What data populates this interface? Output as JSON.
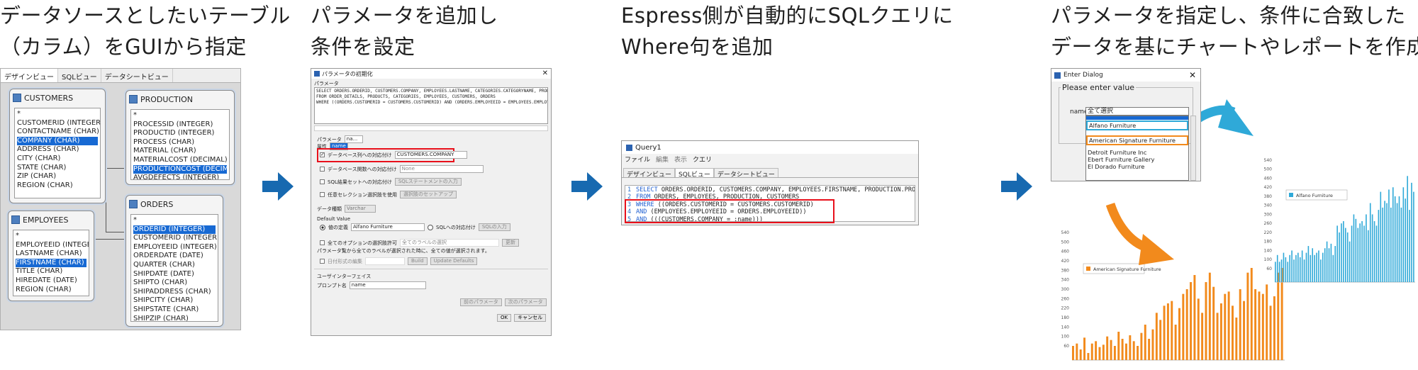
{
  "steps": [
    {
      "line1": "データソースとしたいテーブル",
      "line2": "（カラム）をGUIから指定"
    },
    {
      "line1": "パラメータを追加し",
      "line2": "条件を設定"
    },
    {
      "line1": "Espress側が自動的にSQLクエリに",
      "line2": "Where句を追加"
    },
    {
      "line1": "パラメータを指定し、条件に合致した",
      "line2": "データを基にチャートやレポートを作成"
    }
  ],
  "design_view": {
    "tabs": [
      "デザインビュー",
      "SQLビュー",
      "データシートビュー"
    ],
    "tables": {
      "customers": {
        "name": "CUSTOMERS",
        "columns": [
          "*",
          "CUSTOMERID (INTEGER)",
          "CONTACTNAME (CHAR)",
          "COMPANY (CHAR)",
          "ADDRESS (CHAR)",
          "CITY (CHAR)",
          "STATE (CHAR)",
          "ZIP (CHAR)",
          "REGION (CHAR)"
        ]
      },
      "production": {
        "name": "PRODUCTION",
        "columns": [
          "*",
          "PROCESSID (INTEGER)",
          "PRODUCTID (INTEGER)",
          "PROCESS (CHAR)",
          "MATERIAL (CHAR)",
          "MATERIALCOST (DECIMAL)",
          "PRODUCTIONCOST (DECIMAL)",
          "AVGDEFECTS (INTEGER)"
        ]
      },
      "employees": {
        "name": "EMPLOYEES",
        "columns": [
          "*",
          "EMPLOYEEID (INTEGER)",
          "LASTNAME (CHAR)",
          "FIRSTNAME (CHAR)",
          "TITLE (CHAR)",
          "HIREDATE (DATE)",
          "REGION (CHAR)"
        ]
      },
      "orders": {
        "name": "ORDERS",
        "columns": [
          "*",
          "ORDERID (INTEGER)",
          "CUSTOMERID (INTEGER)",
          "EMPLOYEEID (INTEGER)",
          "ORDERDATE (DATE)",
          "QUARTER (CHAR)",
          "SHIPDATE (DATE)",
          "SHIPTO (CHAR)",
          "SHIPADDRESS (CHAR)",
          "SHIPCITY (CHAR)",
          "SHIPSTATE (CHAR)",
          "SHIPZIP (CHAR)"
        ]
      }
    }
  },
  "param_dialog": {
    "title": "パラメータの初期化",
    "param_label": "パラメータ",
    "sql_lines": [
      "SELECT ORDERS.ORDERID, CUSTOMERS.COMPANY, EMPLOYEES.LASTNAME, CATEGORIES.CATEGORYNAME, PRODUCTS.PRODUCTNAME",
      "FROM ORDER_DETAILS, PRODUCTS, CATEGORIES, EMPLOYEES, CUSTOMERS, ORDERS",
      "WHERE ((ORDERS.CUSTOMERID = CUSTOMERS.CUSTOMERID) AND (ORDERS.EMPLOYEEID = EMPLOYEES.EMPLOYEEID))"
    ],
    "param_field_label": "パラメータ",
    "param_value": "na...",
    "attr_label": "属性",
    "attr_value": "name",
    "db_col_label": "データベース列への対応付け",
    "db_col_value": "CUSTOMERS.COMPANY",
    "db_related_label": "データベース関数への対応付け",
    "db_related_value": "None",
    "sql_result_label": "SQL結果セットへの対応付け",
    "sql_result_btn": "SQLステートメントの入力",
    "any_select_label": "任意セレクション選択肢を使用",
    "any_select_btn": "選択肢のセットアップ",
    "data_type_label": "データ種類",
    "data_type_value": "Varchar",
    "default_label": "Default Value",
    "radio_value_label": "値の定義",
    "radio_value": "Alfano Furniture",
    "radio_sql_label": "SQLへの対応付け",
    "radio_sql_btn": "SQLの入力",
    "all_options_label": "全てのオプションの選択肢許可",
    "all_options_field": "全てのラベルの選択",
    "all_options_btn": "更新",
    "note": "パラメータ覧から全てのラベルが選択された時に、全ての値が選択されます。",
    "date_label": "日付形式の編集",
    "build_btn": "Build",
    "update_btn": "Update Defaults",
    "ui_label": "ユーザインターフェイス",
    "prompt_label": "プロンプト名",
    "prompt_value": "name",
    "prev_btn": "前のパラメータ",
    "next_btn": "次のパラメータ",
    "ok_btn": "OK",
    "cancel_btn": "キャンセル"
  },
  "query": {
    "title": "Query1",
    "menu": [
      "ファイル",
      "編集",
      "表示",
      "クエリ"
    ],
    "tabs": [
      "デザインビュー",
      "SQLビュー",
      "データシートビュー"
    ],
    "lines": [
      {
        "n": "1",
        "kw": "SELECT",
        "rest": " ORDERS.ORDERID, CUSTOMERS.COMPANY, EMPLOYEES.FIRSTNAME, PRODUCTION.PRODUCTIONCOST"
      },
      {
        "n": "2",
        "kw": "FROM",
        "rest": " ORDERS, EMPLOYEES, PRODUCTION, CUSTOMERS"
      },
      {
        "n": "3",
        "kw": "WHERE",
        "rest": " ((ORDERS.CUSTOMERID = CUSTOMERS.CUSTOMERID)"
      },
      {
        "n": "4",
        "kw": "AND",
        "rest": " (EMPLOYEES.EMPLOYEEID = ORDERS.EMPLOYEEID))"
      },
      {
        "n": "5",
        "kw": "AND",
        "rest": " (((CUSTOMERS.COMPANY = :name)))"
      }
    ]
  },
  "enter_dialog": {
    "title": "Enter Dialog",
    "group_label": "Please enter value",
    "name_label": "name",
    "selected": "全て選択",
    "options": [
      "Alfano Furniture",
      "American Signature Furniture",
      "Detroit Furniture Inc",
      "Ebert Furniture Gallery",
      "El Dorado Furniture"
    ]
  },
  "colors": {
    "accent_arrow": "#1769b0",
    "orange": "#f28a1c",
    "blue": "#2fa9d8",
    "highlight_red": "#e8101b"
  },
  "chart_data": [
    {
      "type": "bar",
      "series": [
        {
          "name": "American Signature Furniture"
        }
      ],
      "yticks": [
        60,
        80,
        100,
        120,
        140,
        160,
        180,
        200,
        220,
        240,
        260,
        280,
        300,
        320,
        340,
        360,
        380,
        400,
        420,
        440,
        460,
        480,
        500,
        520,
        540
      ],
      "ylim": [
        0,
        540
      ],
      "values": [
        60,
        70,
        45,
        95,
        30,
        70,
        80,
        55,
        65,
        100,
        85,
        60,
        120,
        90,
        70,
        105,
        80,
        60,
        115,
        150,
        90,
        130,
        200,
        170,
        230,
        240,
        250,
        150,
        220,
        280,
        300,
        330,
        360,
        260,
        200,
        330,
        370,
        310,
        200,
        240,
        280,
        290,
        230,
        180,
        300,
        250,
        370,
        390,
        300,
        290,
        280,
        320,
        230,
        270,
        370,
        390
      ]
    },
    {
      "type": "bar",
      "series": [
        {
          "name": "Alfano Furniture"
        }
      ],
      "yticks": [
        60,
        80,
        100,
        120,
        140,
        160,
        180,
        200,
        220,
        240,
        260,
        280,
        300,
        320,
        340,
        360,
        380,
        400,
        420,
        440,
        460,
        480,
        500,
        520,
        540
      ],
      "ylim": [
        0,
        540
      ],
      "values": [
        90,
        120,
        90,
        100,
        130,
        110,
        90,
        120,
        140,
        100,
        120,
        130,
        110,
        140,
        100,
        130,
        160,
        120,
        150,
        120,
        130,
        140,
        100,
        130,
        150,
        180,
        150,
        170,
        120,
        160,
        250,
        220,
        260,
        270,
        240,
        220,
        180,
        250,
        300,
        280,
        240,
        260,
        270,
        250,
        300,
        230,
        350,
        300,
        270,
        250,
        320,
        400,
        330,
        360,
        350,
        410,
        330,
        420,
        380,
        350,
        380,
        330,
        420,
        370,
        470,
        320,
        440,
        400
      ]
    }
  ]
}
